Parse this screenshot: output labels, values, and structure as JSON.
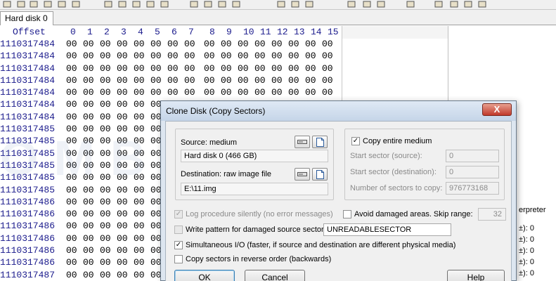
{
  "toolbar": {
    "icons": [
      "new-icon",
      "open-icon",
      "save-icon",
      "print-icon",
      "properties-icon",
      "undo-icon",
      "copy-icon",
      "paste-icon",
      "paste-special-icon",
      "find-icon",
      "find-hex-icon",
      "replace-icon",
      "replace-hex-icon",
      "goto-icon",
      "goto-offset-icon",
      "back-icon",
      "forward-icon",
      "disk-icon",
      "ram-icon",
      "calc-icon",
      "tools-icon",
      "prev-icon",
      "next-icon",
      "stop-icon",
      "menu-icon",
      "book-icon"
    ]
  },
  "tabs": [
    {
      "label": "Hard disk 0"
    }
  ],
  "hex": {
    "offset_label": "Offset",
    "columns": [
      "0",
      "1",
      "2",
      "3",
      "4",
      "5",
      "6",
      "7",
      "8",
      "9",
      "10",
      "11",
      "12",
      "13",
      "14",
      "15"
    ],
    "rows": [
      {
        "offset": "1110317484"
      },
      {
        "offset": "1110317484"
      },
      {
        "offset": "1110317484"
      },
      {
        "offset": "1110317484"
      },
      {
        "offset": "1110317484"
      },
      {
        "offset": "1110317484"
      },
      {
        "offset": "1110317484"
      },
      {
        "offset": "1110317485"
      },
      {
        "offset": "1110317485"
      },
      {
        "offset": "1110317485"
      },
      {
        "offset": "1110317485"
      },
      {
        "offset": "1110317485"
      },
      {
        "offset": "1110317485"
      },
      {
        "offset": "1110317486"
      },
      {
        "offset": "1110317486"
      },
      {
        "offset": "1110317486"
      },
      {
        "offset": "1110317486"
      },
      {
        "offset": "1110317486"
      },
      {
        "offset": "1110317486"
      },
      {
        "offset": "1110317487"
      },
      {
        "offset": "1110317487"
      }
    ],
    "byte_value": "00"
  },
  "interpreter": {
    "title": "erpreter",
    "rows": [
      {
        "label": "±): 0"
      },
      {
        "label": "±): 0"
      },
      {
        "label": "±): 0"
      },
      {
        "label": "±): 0"
      },
      {
        "label": "±): 0"
      },
      {
        "label": "±): 0"
      }
    ]
  },
  "watermark": "OMBYTE",
  "dialog": {
    "title": "Clone Disk (Copy Sectors)",
    "close_label": "X",
    "source_label": "Source: medium",
    "source_value": "Hard disk 0 (466 GB)",
    "dest_label": "Destination: raw image file",
    "dest_value": "E:\\11.img",
    "copy_entire_label": "Copy entire medium",
    "start_source_label": "Start sector (source):",
    "start_source_value": "0",
    "start_dest_label": "Start sector (destination):",
    "start_dest_value": "0",
    "num_sectors_label": "Number of sectors to copy:",
    "num_sectors_value": "976773168",
    "log_label": "Log procedure silently (no error messages)",
    "avoid_label": "Avoid damaged areas. Skip range:",
    "skip_range_value": "32",
    "write_pattern_label": "Write pattern for damaged source sectors:",
    "pattern_value": "UNREADABLESECTOR",
    "simultaneous_label": "Simultaneous I/O (faster, if source and destination are different physical media)",
    "reverse_label": "Copy sectors in reverse order (backwards)",
    "ok_label": "OK",
    "cancel_label": "Cancel",
    "help_label": "Help",
    "check_mark": "✓"
  }
}
